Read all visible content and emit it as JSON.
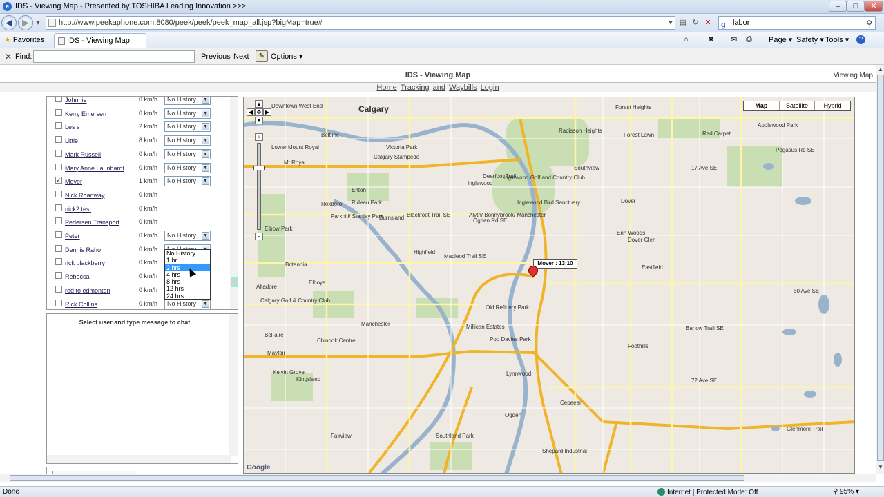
{
  "window": {
    "title": "IDS - Viewing Map - Presented by TOSHIBA Leading Innovation >>>"
  },
  "address": {
    "url": "http://www.peekaphone.com:8080/peek/peek/peek_map_all.jsp?bigMap=true#"
  },
  "search": {
    "value": "labor"
  },
  "favorites": {
    "label": "Favorites"
  },
  "tab": {
    "label": "IDS - Viewing Map"
  },
  "commands": {
    "page": "Page ▾",
    "safety": "Safety ▾",
    "tools": "Tools ▾",
    "help": "?"
  },
  "findbar": {
    "label": "Find:",
    "previous": "Previous",
    "next": "Next",
    "options": "Options"
  },
  "page": {
    "title": "IDS - Viewing Map",
    "title_right": "Viewing Map",
    "links": [
      "Home",
      "Tracking",
      "and",
      "Waybills",
      "Login"
    ]
  },
  "users": [
    {
      "name": "Johnnie",
      "speed": "0 km/h",
      "history": "No History",
      "checked": false
    },
    {
      "name": "Kerry Emersen",
      "speed": "0 km/h",
      "history": "No History",
      "checked": false
    },
    {
      "name": "Les s",
      "speed": "2 km/h",
      "history": "No History",
      "checked": false
    },
    {
      "name": "Little",
      "speed": "8 km/h",
      "history": "No History",
      "checked": false
    },
    {
      "name": "Mark Russell",
      "speed": "0 km/h",
      "history": "No History",
      "checked": false
    },
    {
      "name": "Mary Anne Launhardt",
      "speed": "0 km/h",
      "history": "No History",
      "checked": false
    },
    {
      "name": "Mover",
      "speed": "1 km/h",
      "history": "No History",
      "checked": true
    },
    {
      "name": "Nick Roadway",
      "speed": "0 km/h",
      "history": "",
      "checked": false
    },
    {
      "name": "nick2 test",
      "speed": "0 km/h",
      "history": "",
      "checked": false
    },
    {
      "name": "Pedersen Transport",
      "speed": "0 km/h",
      "history": "",
      "checked": false
    },
    {
      "name": "Peter",
      "speed": "0 km/h",
      "history": "No History",
      "checked": false
    },
    {
      "name": "Dennis Raho",
      "speed": "0 km/h",
      "history": "No History",
      "checked": false
    },
    {
      "name": "rick blackberry",
      "speed": "0 km/h",
      "history": "No History",
      "checked": false
    },
    {
      "name": "Rebecca",
      "speed": "0 km/h",
      "history": "No History",
      "checked": false
    },
    {
      "name": "red to edmonton",
      "speed": "0 km/h",
      "history": "No History",
      "checked": false
    },
    {
      "name": "Rick Collins",
      "speed": "0 km/h",
      "history": "No History",
      "checked": false
    }
  ],
  "history_options": [
    "No History",
    "1 hr",
    "2 hrs",
    "4 hrs",
    "8 hrs",
    "12 hrs",
    "24 hrs"
  ],
  "history_highlighted": "2 hrs",
  "chat": {
    "message": "Select user and type message to chat"
  },
  "map": {
    "types": [
      "Map",
      "Satellite",
      "Hybrid"
    ],
    "active_type": "Map",
    "marker_label": "Mover : 13:10",
    "labels": [
      "Calgary",
      "Downtown West End",
      "Beltline",
      "Victoria Park",
      "Calgary Stampede",
      "Mt Royal",
      "Lower Mount Royal",
      "Erlton",
      "Roxboro",
      "Rideau Park",
      "Parkhill/ Stanley Park",
      "Burnsland",
      "Inglewood",
      "Inglewood Golf and Country Club",
      "Inglewood Bird Sanctuary",
      "Alyth/ Bonnybrook/ Manchester",
      "Highfield",
      "Dover",
      "Dover Glen",
      "Southview",
      "Radisson Heights",
      "Forest Heights",
      "Forest Lawn",
      "Red Carpet",
      "Applewood Park",
      "Erin Woods",
      "Eastfield",
      "Elbow Park",
      "Britannia",
      "Elboya",
      "Altadore",
      "Calgary Golf & Country Club",
      "Manchester",
      "Old Refinery Park",
      "Millican Estates",
      "Pop Davies Park",
      "Chinook Centre",
      "Mayfair",
      "Bel-aire",
      "Kelvin Grove",
      "Kingsland",
      "Lynnwood",
      "Ogden",
      "Cepeear",
      "Fairview",
      "Southland Park",
      "Shepard Industrial",
      "Foothills",
      "Glenmore Trail",
      "17 Ave SE",
      "50 Ave SE",
      "72 Ave SE",
      "Barlow Trail SE",
      "Deerfoot Trail",
      "Blackfoot Trail SE",
      "Macleod Trail SE",
      "Ogden Rd SE",
      "Pegasus Rd SE"
    ],
    "google": "Google"
  },
  "status": {
    "left": "Done",
    "zone": "Internet | Protected Mode: Off",
    "zoom": "95%"
  }
}
